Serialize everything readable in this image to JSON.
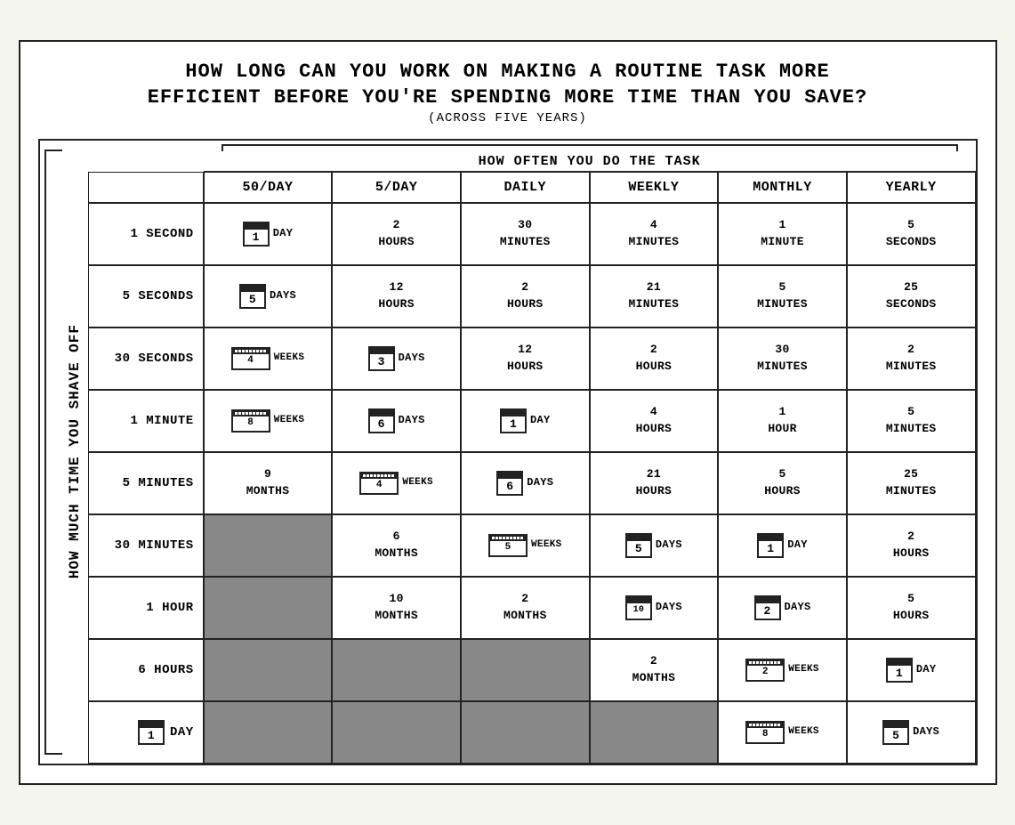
{
  "title": {
    "line1": "HOW LONG CAN YOU WORK ON MAKING A ROUTINE TASK MORE",
    "line2": "EFFICIENT BEFORE YOU'RE SPENDING MORE TIME THAN YOU SAVE?",
    "line3": "(ACROSS FIVE YEARS)"
  },
  "header": {
    "how_often_label": "HOW OFTEN YOU DO THE TASK",
    "columns": [
      "50/DAY",
      "5/DAY",
      "DAILY",
      "WEEKLY",
      "MONTHLY",
      "YEARLY"
    ]
  },
  "left_label": "HOW MUCH TIME YOU SHAVE OFF",
  "rows": [
    {
      "label": "1 SECOND",
      "cells": [
        {
          "text": "1 DAY",
          "type": "calendar",
          "num": "1",
          "unit": "DAY"
        },
        {
          "text": "2 HOURS",
          "type": "plain"
        },
        {
          "text": "30 MINUTES",
          "type": "plain"
        },
        {
          "text": "4 MINUTES",
          "type": "plain"
        },
        {
          "text": "1 MINUTE",
          "type": "plain"
        },
        {
          "text": "5 SECONDS",
          "type": "plain"
        }
      ]
    },
    {
      "label": "5 SECONDS",
      "cells": [
        {
          "text": "5 DAYS",
          "type": "calendar",
          "num": "5",
          "unit": "DAYS"
        },
        {
          "text": "12 HOURS",
          "type": "plain"
        },
        {
          "text": "2 HOURS",
          "type": "plain"
        },
        {
          "text": "21 MINUTES",
          "type": "plain"
        },
        {
          "text": "5 MINUTES",
          "type": "plain"
        },
        {
          "text": "25 SECONDS",
          "type": "plain"
        }
      ]
    },
    {
      "label": "30 SECONDS",
      "cells": [
        {
          "text": "4 WEEKS",
          "type": "weeks",
          "num": "4",
          "unit": "WEEKS"
        },
        {
          "text": "3 DAYS",
          "type": "calendar",
          "num": "3",
          "unit": "DAYS"
        },
        {
          "text": "12 HOURS",
          "type": "plain"
        },
        {
          "text": "2 HOURS",
          "type": "plain"
        },
        {
          "text": "30 MINUTES",
          "type": "plain"
        },
        {
          "text": "2 MINUTES",
          "type": "plain"
        }
      ]
    },
    {
      "label": "1 MINUTE",
      "cells": [
        {
          "text": "8 WEEKS",
          "type": "weeks",
          "num": "8",
          "unit": "WEEKS"
        },
        {
          "text": "6 DAYS",
          "type": "calendar",
          "num": "6",
          "unit": "DAYS"
        },
        {
          "text": "1 DAY",
          "type": "calendar",
          "num": "1",
          "unit": "DAY"
        },
        {
          "text": "4 HOURS",
          "type": "plain"
        },
        {
          "text": "1 HOUR",
          "type": "plain"
        },
        {
          "text": "5 MINUTES",
          "type": "plain"
        }
      ]
    },
    {
      "label": "5 MINUTES",
      "cells": [
        {
          "text": "9 MONTHS",
          "type": "plain"
        },
        {
          "text": "4 WEEKS",
          "type": "weeks",
          "num": "4",
          "unit": "WEEKS"
        },
        {
          "text": "6 DAYS",
          "type": "calendar",
          "num": "6",
          "unit": "DAYS"
        },
        {
          "text": "21 HOURS",
          "type": "plain"
        },
        {
          "text": "5 HOURS",
          "type": "plain"
        },
        {
          "text": "25 MINUTES",
          "type": "plain"
        }
      ]
    },
    {
      "label": "30 MINUTES",
      "cells": [
        {
          "text": "",
          "type": "dark"
        },
        {
          "text": "6 MONTHS",
          "type": "plain"
        },
        {
          "text": "5 WEEKS",
          "type": "weeks",
          "num": "5",
          "unit": "WEEKS"
        },
        {
          "text": "5 DAYS",
          "type": "calendar",
          "num": "5",
          "unit": "DAYS"
        },
        {
          "text": "1 DAY",
          "type": "calendar",
          "num": "1",
          "unit": "DAY"
        },
        {
          "text": "2 HOURS",
          "type": "plain"
        }
      ]
    },
    {
      "label": "1 HOUR",
      "cells": [
        {
          "text": "",
          "type": "dark"
        },
        {
          "text": "10 MONTHS",
          "type": "plain"
        },
        {
          "text": "2 MONTHS",
          "type": "plain"
        },
        {
          "text": "10 DAYS",
          "type": "calendar",
          "num": "10",
          "unit": "DAYS"
        },
        {
          "text": "2 DAYS",
          "type": "calendar",
          "num": "2",
          "unit": "DAYS"
        },
        {
          "text": "5 HOURS",
          "type": "plain"
        }
      ]
    },
    {
      "label": "6 HOURS",
      "cells": [
        {
          "text": "",
          "type": "dark"
        },
        {
          "text": "",
          "type": "dark"
        },
        {
          "text": "",
          "type": "dark"
        },
        {
          "text": "2 MONTHS",
          "type": "plain"
        },
        {
          "text": "2 WEEKS",
          "type": "weeks",
          "num": "2",
          "unit": "WEEKS"
        },
        {
          "text": "1 DAY",
          "type": "calendar",
          "num": "1",
          "unit": "DAY"
        }
      ]
    },
    {
      "label": "1 DAY",
      "cells": [
        {
          "text": "",
          "type": "dark"
        },
        {
          "text": "",
          "type": "dark"
        },
        {
          "text": "",
          "type": "dark"
        },
        {
          "text": "",
          "type": "dark"
        },
        {
          "text": "8 WEEKS",
          "type": "weeks",
          "num": "8",
          "unit": "WEEKS"
        },
        {
          "text": "5 DAYS",
          "type": "calendar",
          "num": "5",
          "unit": "DAYS"
        }
      ]
    }
  ]
}
